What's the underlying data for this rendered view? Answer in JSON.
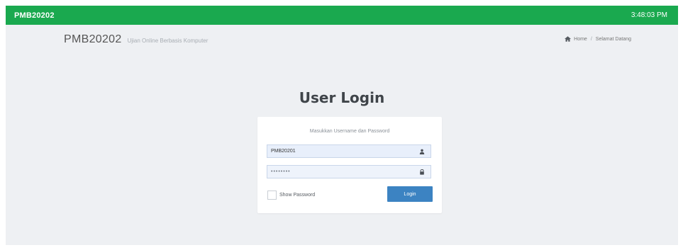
{
  "topbar": {
    "brand": "PMB20202",
    "time": "3:48:03 PM"
  },
  "subheader": {
    "title": "PMB20202",
    "subtitle": "Ujian Online Berbasis Komputer"
  },
  "breadcrumb": {
    "home_icon": "home-icon",
    "home": "Home",
    "current": "Selamat Datang"
  },
  "login": {
    "heading": "User Login",
    "instruction": "Masukkan Username dan Password",
    "username_value": "PMB20201",
    "password_value": "••••••••",
    "show_password_label": "Show Password",
    "login_button": "Login",
    "user_icon": "user-icon",
    "lock_icon": "lock-icon"
  },
  "colors": {
    "topbar": "#1aa94f",
    "page_background": "#eef0f3",
    "button": "#3c83c2"
  }
}
